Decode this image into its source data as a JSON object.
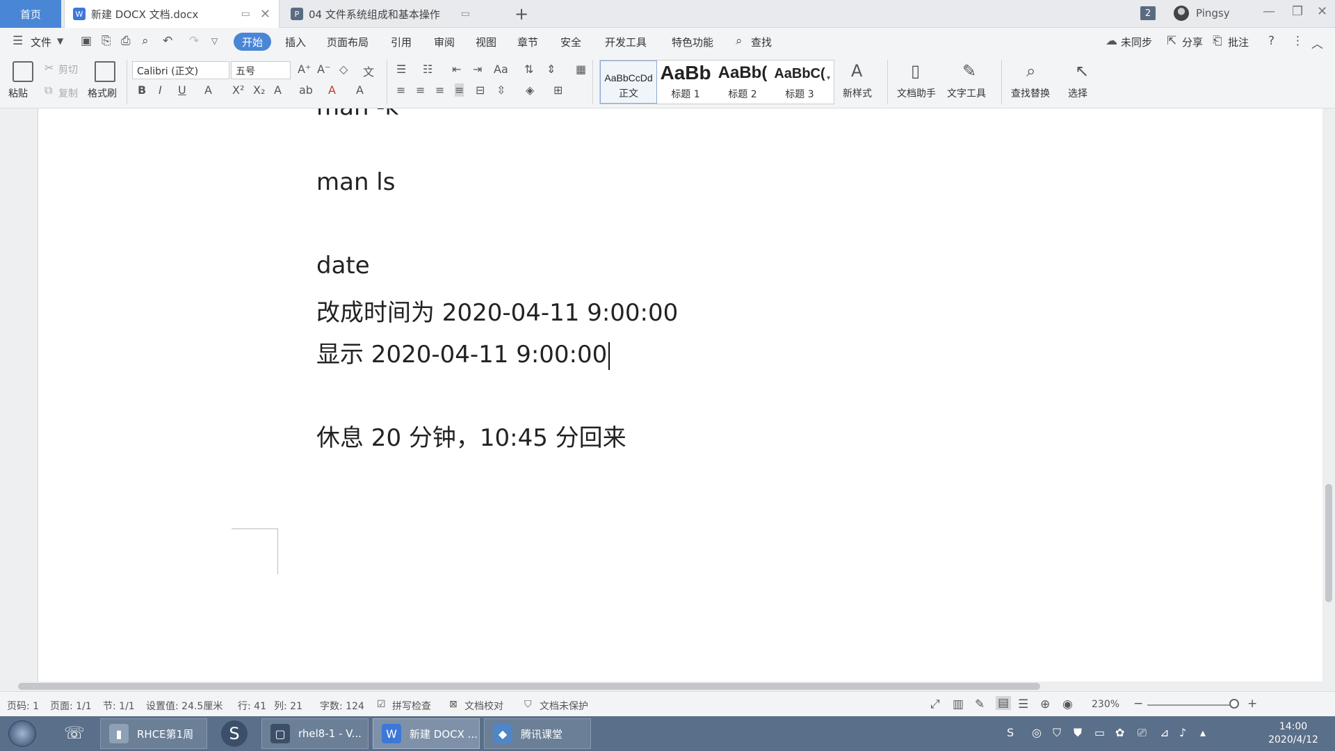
{
  "tabs": {
    "home": "首页",
    "doc1": "新建 DOCX 文档.docx",
    "doc2": "04 文件系统组成和基本操作",
    "count": "2",
    "user": "Pingsy"
  },
  "menu": {
    "file": "文件",
    "items": [
      "开始",
      "插入",
      "页面布局",
      "引用",
      "审阅",
      "视图",
      "章节",
      "安全",
      "开发工具",
      "特色功能"
    ],
    "search": "查找",
    "sync": "未同步",
    "share": "分享",
    "comment": "批注"
  },
  "ribbon": {
    "paste": "粘贴",
    "cut": "剪切",
    "copy": "复制",
    "format_painter": "格式刷",
    "font_name": "Calibri (正文)",
    "font_size": "五号",
    "styles": [
      {
        "sample": "AaBbCcDd",
        "name": "正文"
      },
      {
        "sample": "AaBb",
        "name": "标题 1"
      },
      {
        "sample": "AaBb(",
        "name": "标题 2"
      },
      {
        "sample": "AaBbC(",
        "name": "标题 3"
      }
    ],
    "new_style": "新样式",
    "doc_helper": "文档助手",
    "text_tools": "文字工具",
    "find_replace": "查找替换",
    "select": "选择"
  },
  "document": {
    "partial_line": "man  -k",
    "lines": [
      "man ls",
      "date",
      "改成时间为 2020-04-11 9:00:00",
      "显示 2020-04-11 9:00:00",
      "休息 20 分钟，10:45 分回来"
    ]
  },
  "status": {
    "page_code": "页码: 1",
    "page": "页面: 1/1",
    "section": "节: 1/1",
    "setting": "设置值: 24.5厘米",
    "row": "行: 41",
    "col": "列: 21",
    "word_count": "字数: 124",
    "spell": "拼写检查",
    "proof": "文档校对",
    "protect": "文档未保护",
    "zoom": "230%"
  },
  "taskbar": {
    "items": [
      "RHCE第1周",
      "rhel8-1 - V...",
      "新建 DOCX ...",
      "腾讯课堂"
    ],
    "time": "14:00",
    "date": "2020/4/12"
  }
}
